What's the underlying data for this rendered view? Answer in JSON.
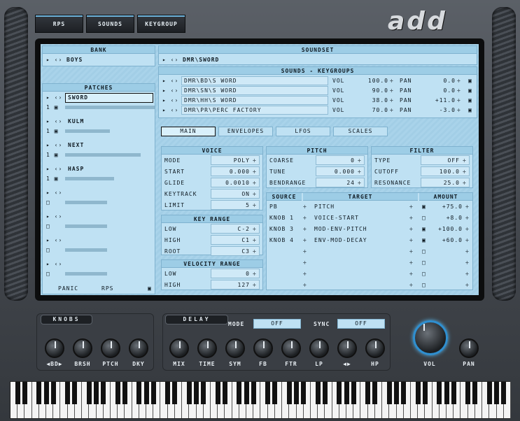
{
  "tabs": [
    "RPS",
    "SOUNDS",
    "KEYGROUP"
  ],
  "logo": "add",
  "bank": {
    "header": "BANK",
    "value": "BOYS"
  },
  "patches": {
    "header": "PATCHES",
    "items": [
      "SWORD",
      "KULM",
      "NEXT",
      "HASP",
      "",
      "",
      "",
      ""
    ],
    "footer": {
      "panic": "PANIC",
      "rps": "RPS"
    }
  },
  "soundset": {
    "header": "SOUNDSET",
    "value": "DMR\\SWORD"
  },
  "sounds": {
    "header": "SOUNDS - KEYGROUPS",
    "vol_label": "VOL",
    "pan_label": "PAN",
    "rows": [
      {
        "name": "DMR\\BD\\S WORD",
        "vol": "100.0",
        "pan": "0.0"
      },
      {
        "name": "DMR\\SN\\S WORD",
        "vol": "90.0",
        "pan": "0.0"
      },
      {
        "name": "DMR\\HH\\S WORD",
        "vol": "38.0",
        "pan": "+11.0"
      },
      {
        "name": "DMR\\PR\\PERC FACTORY",
        "vol": "70.0",
        "pan": "-3.0"
      }
    ]
  },
  "subtabs": [
    "MAIN",
    "ENVELOPES",
    "LFOS",
    "SCALES"
  ],
  "voice": {
    "header": "VOICE",
    "rows": [
      [
        "MODE",
        "POLY"
      ],
      [
        "START",
        "0.000"
      ],
      [
        "GLIDE",
        "0.0010"
      ],
      [
        "KEYTRACK",
        "ON"
      ],
      [
        "LIMIT",
        "5"
      ]
    ]
  },
  "keyrange": {
    "header": "KEY RANGE",
    "rows": [
      [
        "LOW",
        "C-2"
      ],
      [
        "HIGH",
        "C1"
      ],
      [
        "ROOT",
        "C3"
      ]
    ]
  },
  "velrange": {
    "header": "VELOCITY RANGE",
    "rows": [
      [
        "LOW",
        "0"
      ],
      [
        "HIGH",
        "127"
      ]
    ]
  },
  "pitch": {
    "header": "PITCH",
    "rows": [
      [
        "COARSE",
        "0"
      ],
      [
        "TUNE",
        "0.000"
      ],
      [
        "BENDRANGE",
        "24"
      ]
    ]
  },
  "filter": {
    "header": "FILTER",
    "rows": [
      [
        "TYPE",
        "OFF"
      ],
      [
        "CUTOFF",
        "100.0"
      ],
      [
        "RESONANCE",
        "25.0"
      ]
    ]
  },
  "mod": {
    "headers": [
      "SOURCE",
      "TARGET",
      "AMOUNT"
    ],
    "rows": [
      [
        "PB",
        "PITCH",
        "+75.0"
      ],
      [
        "KNOB 1",
        "VOICE-START",
        "+8.0"
      ],
      [
        "KNOB 3",
        "MOD-ENV-PITCH",
        "+100.0"
      ],
      [
        "KNOB 4",
        "ENV-MOD-DECAY",
        "+60.0"
      ],
      [
        "",
        "",
        ""
      ],
      [
        "",
        "",
        ""
      ],
      [
        "",
        "",
        ""
      ],
      [
        "",
        "",
        ""
      ]
    ]
  },
  "knobs": {
    "label": "KNOBS",
    "items": [
      "◀BD▶",
      "BRSH",
      "PTCH",
      "DKY"
    ]
  },
  "delay": {
    "label": "DELAY",
    "mode_label": "MODE",
    "mode": "OFF",
    "sync_label": "SYNC",
    "sync": "OFF",
    "items": [
      "MIX",
      "TIME",
      "SYM",
      "FB",
      "FTR",
      "LP",
      "◀▶",
      "HP"
    ]
  },
  "output": {
    "vol": "VOL",
    "pan": "PAN"
  }
}
